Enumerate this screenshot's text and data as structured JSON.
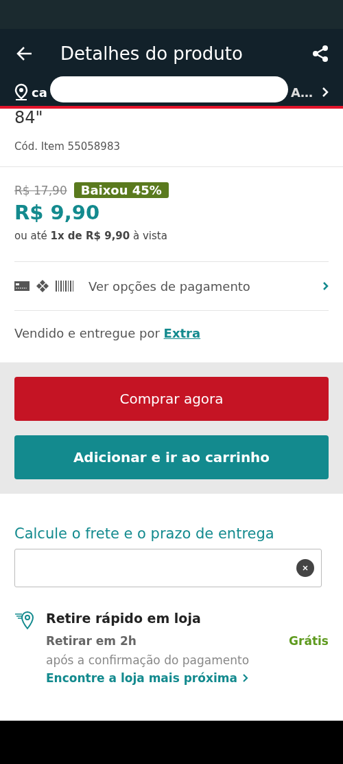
{
  "header": {
    "title": "Detalhes do produto",
    "address_start": "ca",
    "address_end": "A…"
  },
  "product": {
    "title_tail": "84\"",
    "code": "Cód. Item 55058983"
  },
  "price": {
    "old": "R$ 17,90",
    "badge": "Baixou 45%",
    "current": "R$ 9,90",
    "installments": "ou até **1x de R$ 9,90** à vista"
  },
  "payment": {
    "label": "Ver opções de pagamento"
  },
  "seller": {
    "text": "Vendido e entregue por",
    "link": "Extra"
  },
  "buttons": [
    {
      "label": "Comprar agora",
      "kind": "primary"
    },
    {
      "label": "Adicionar e ir ao carrinho",
      "kind": "secondary"
    }
  ],
  "shipping": {
    "title": "Calcule o frete e o prazo de entrega"
  },
  "pickup": {
    "title": "Retire rápido em loja",
    "time": "Retirar em 2h",
    "price": "Grátis",
    "note": "após a confirmação do pagamento",
    "link": "Encontre a loja mais próxima"
  }
}
